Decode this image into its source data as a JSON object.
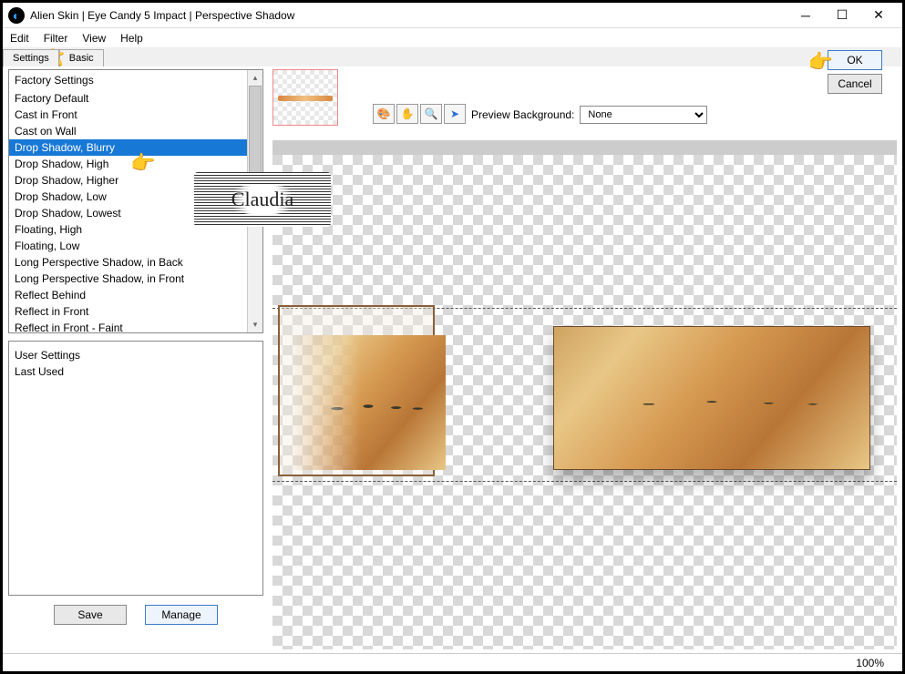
{
  "window": {
    "title": "Alien Skin | Eye Candy 5 Impact | Perspective Shadow"
  },
  "menu": {
    "edit": "Edit",
    "filter": "Filter",
    "view": "View",
    "help": "Help"
  },
  "tabs": {
    "settings": "Settings",
    "basic": "Basic"
  },
  "factory": {
    "header": "Factory Settings",
    "items": [
      "Factory Default",
      "Cast in Front",
      "Cast on Wall",
      "Drop Shadow, Blurry",
      "Drop Shadow, High",
      "Drop Shadow, Higher",
      "Drop Shadow, Low",
      "Drop Shadow, Lowest",
      "Floating, High",
      "Floating, Low",
      "Long Perspective Shadow, in Back",
      "Long Perspective Shadow, in Front",
      "Reflect Behind",
      "Reflect in Front",
      "Reflect in Front - Faint"
    ],
    "selected_index": 3
  },
  "user": {
    "header": "User Settings",
    "last_used": "Last Used"
  },
  "buttons": {
    "save": "Save",
    "manage": "Manage",
    "ok": "OK",
    "cancel": "Cancel"
  },
  "preview": {
    "label": "Preview Background:",
    "value": "None"
  },
  "status": {
    "zoom": "100%"
  }
}
